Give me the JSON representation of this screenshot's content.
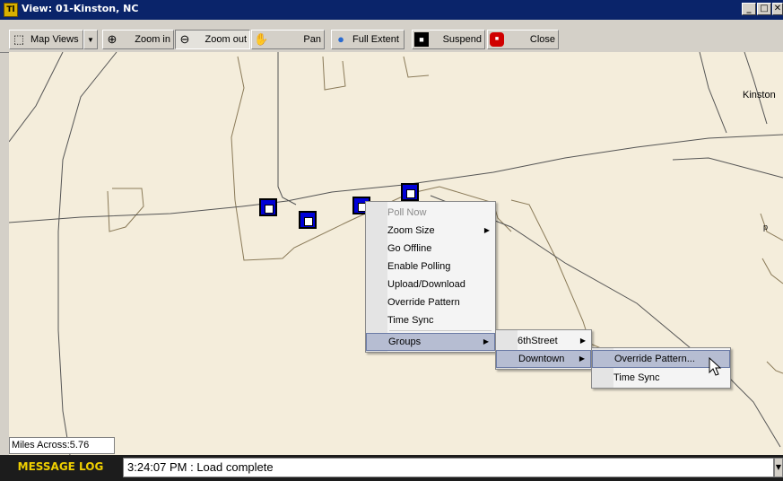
{
  "window": {
    "title": "View: 01-Kinston, NC",
    "app_icon": "traffic-app-icon",
    "controls": {
      "minimize": "_",
      "maximize": "□",
      "close": "✕"
    }
  },
  "toolbar": {
    "map_views": "Map Views",
    "zoom_in": "Zoom in",
    "zoom_out": "Zoom out",
    "pan": "Pan",
    "full_extent": "Full Extent",
    "suspend": "Suspend",
    "close": "Close"
  },
  "map": {
    "place_label": "Kinston",
    "small_label": "p",
    "miles_across": "Miles Across:5.76",
    "background_color": "#f4eddb",
    "signal_color": "#0000d8"
  },
  "context_menu": {
    "items": [
      {
        "label": "Poll Now",
        "disabled": true
      },
      {
        "label": "Zoom Size",
        "submenu": true
      },
      {
        "label": "Go Offline"
      },
      {
        "label": "Enable Polling"
      },
      {
        "label": "Upload/Download"
      },
      {
        "label": "Override Pattern"
      },
      {
        "label": "Time Sync"
      },
      {
        "label": "Groups",
        "submenu": true,
        "highlighted": true
      }
    ]
  },
  "groups_menu": {
    "items": [
      {
        "label": "6thStreet",
        "submenu": true
      },
      {
        "label": "Downtown",
        "submenu": true,
        "highlighted": true
      }
    ]
  },
  "downtown_menu": {
    "items": [
      {
        "label": "Override Pattern...",
        "highlighted": true
      },
      {
        "label": "Time Sync"
      }
    ]
  },
  "message_log": {
    "label": "MESSAGE LOG",
    "text": "3:24:07 PM  : Load complete"
  }
}
